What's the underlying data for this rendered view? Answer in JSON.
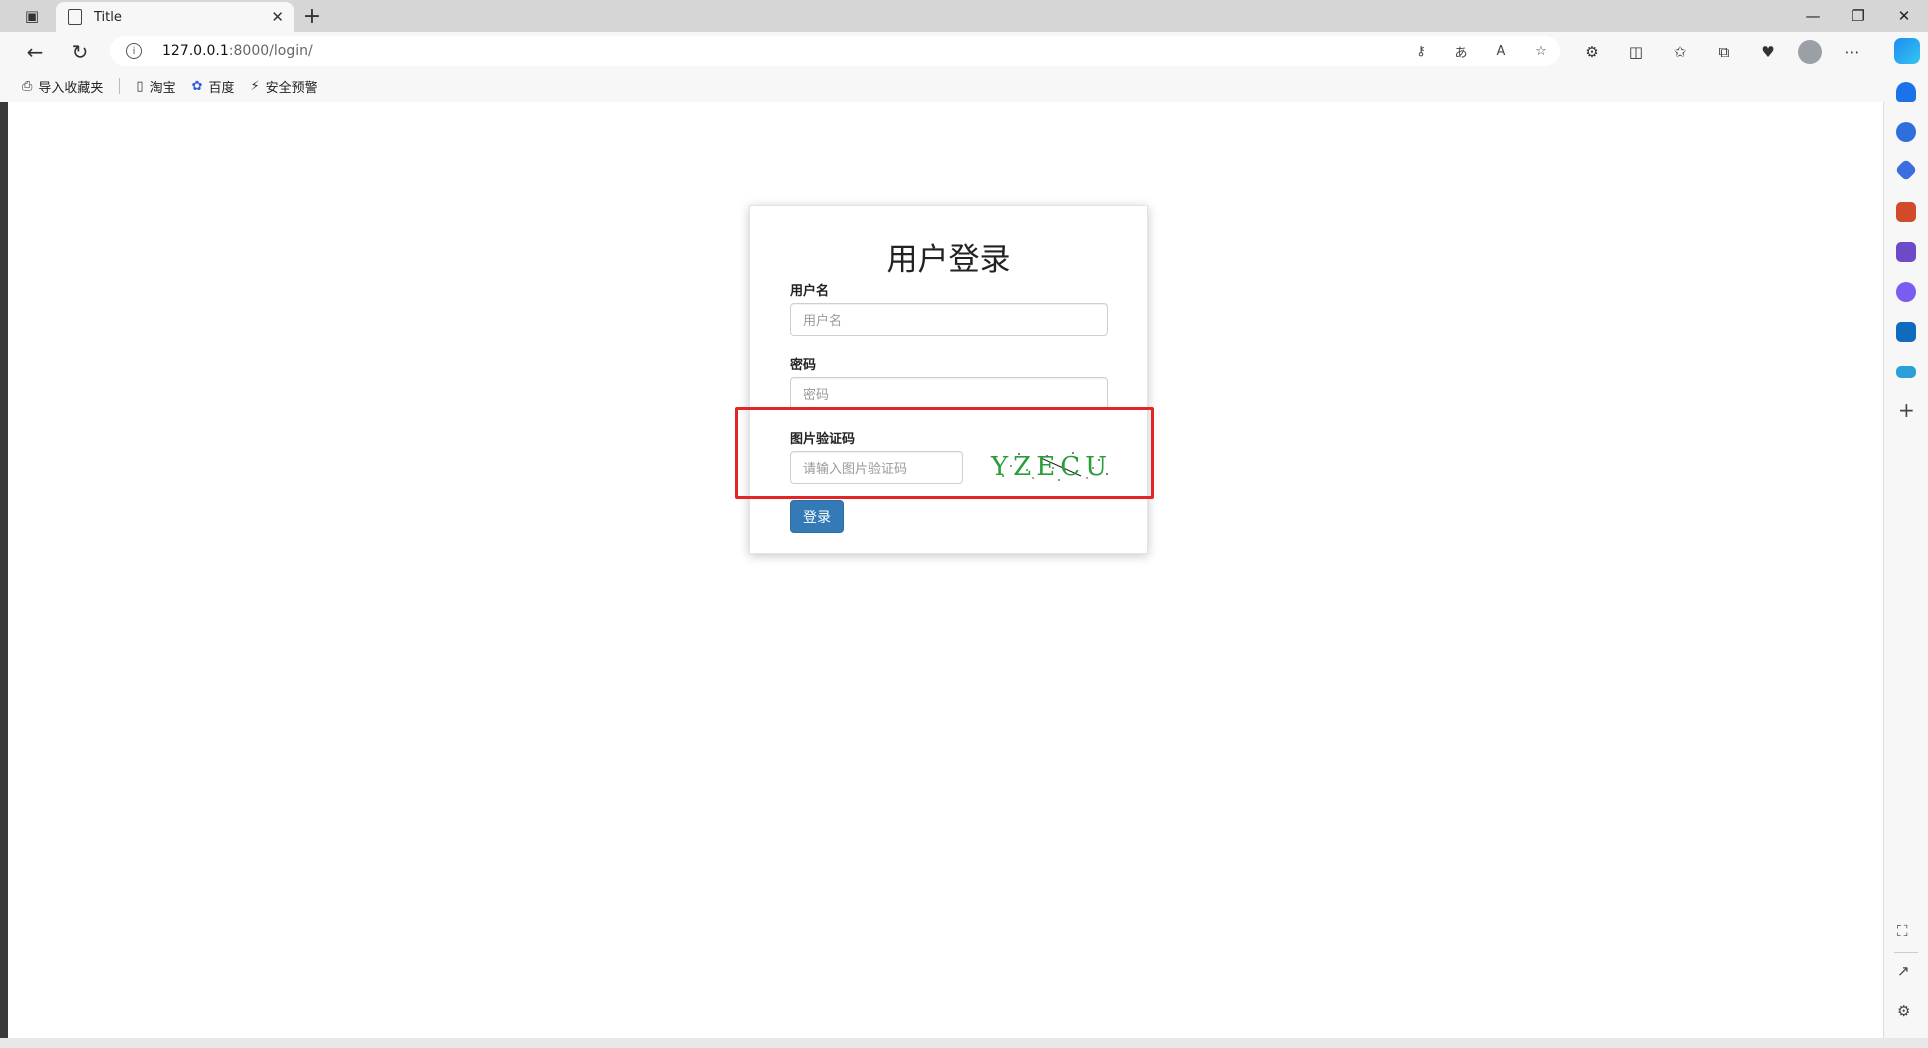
{
  "browser": {
    "tab_title": "Title",
    "url_host": "127.0.0.1",
    "url_path": ":8000/login/",
    "bookmarks": [
      "导入收藏夹",
      "淘宝",
      "百度",
      "安全预警"
    ]
  },
  "login": {
    "title": "用户登录",
    "username_label": "用户名",
    "username_placeholder": "用户名",
    "password_label": "密码",
    "password_placeholder": "密码",
    "captcha_label": "图片验证码",
    "captcha_placeholder": "请输入图片验证码",
    "captcha_text": "YZECU",
    "submit_label": "登录"
  },
  "colors": {
    "primary_button": "#337ab7",
    "highlight_box": "#e32526"
  }
}
